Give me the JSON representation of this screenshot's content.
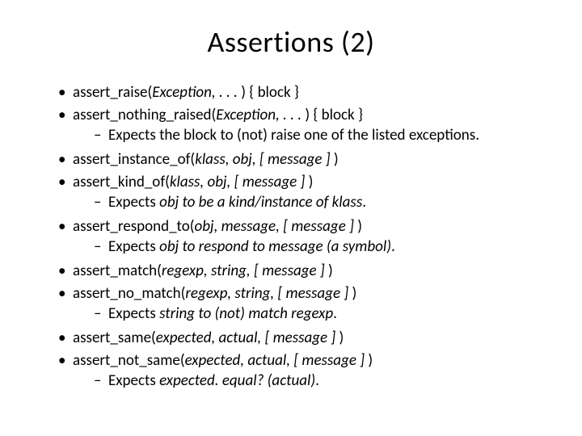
{
  "slide": {
    "title": "Assertions (2)",
    "items": [
      {
        "pre": "assert_raise(",
        "it": "Exception, . . . ",
        "post": ") { block }"
      },
      {
        "pre": "assert_nothing_raised(",
        "it": "Exception, . . . ",
        "post": ") { block }",
        "sub": [
          {
            "pre": "Expects the block to (not) raise one of the listed exceptions."
          }
        ]
      },
      {
        "pre": "assert_instance_of(",
        "it": "klass, obj, [ message ] ",
        "post": ")"
      },
      {
        "pre": "assert_kind_of(",
        "it": "klass, obj, [ message ] ",
        "post": ")",
        "sub": [
          {
            "pre": "Expects ",
            "it": "obj to be a kind/instance of klass",
            "post": "."
          }
        ]
      },
      {
        "pre": "assert_respond_to(",
        "it": "obj, message, [ message ] ",
        "post": ")",
        "sub": [
          {
            "pre": "Expects ",
            "it": "obj to respond to message (a symbol)",
            "post": "."
          }
        ]
      },
      {
        "pre": "assert_match(",
        "it": "regexp, string, [ message ] ",
        "post": ")"
      },
      {
        "pre": "assert_no_match(",
        "it": "regexp, string, [ message ] ",
        "post": ")",
        "sub": [
          {
            "pre": "Expects ",
            "it": "string to (not) match regexp",
            "post": "."
          }
        ]
      },
      {
        "pre": "assert_same(",
        "it": "expected, actual, [ message ] ",
        "post": ")"
      },
      {
        "pre": "assert_not_same(",
        "it": "expected, actual, [ message ] ",
        "post": ")",
        "sub": [
          {
            "pre": "Expects ",
            "it": "expected. equal? (actual)",
            "post": "."
          }
        ]
      }
    ]
  }
}
